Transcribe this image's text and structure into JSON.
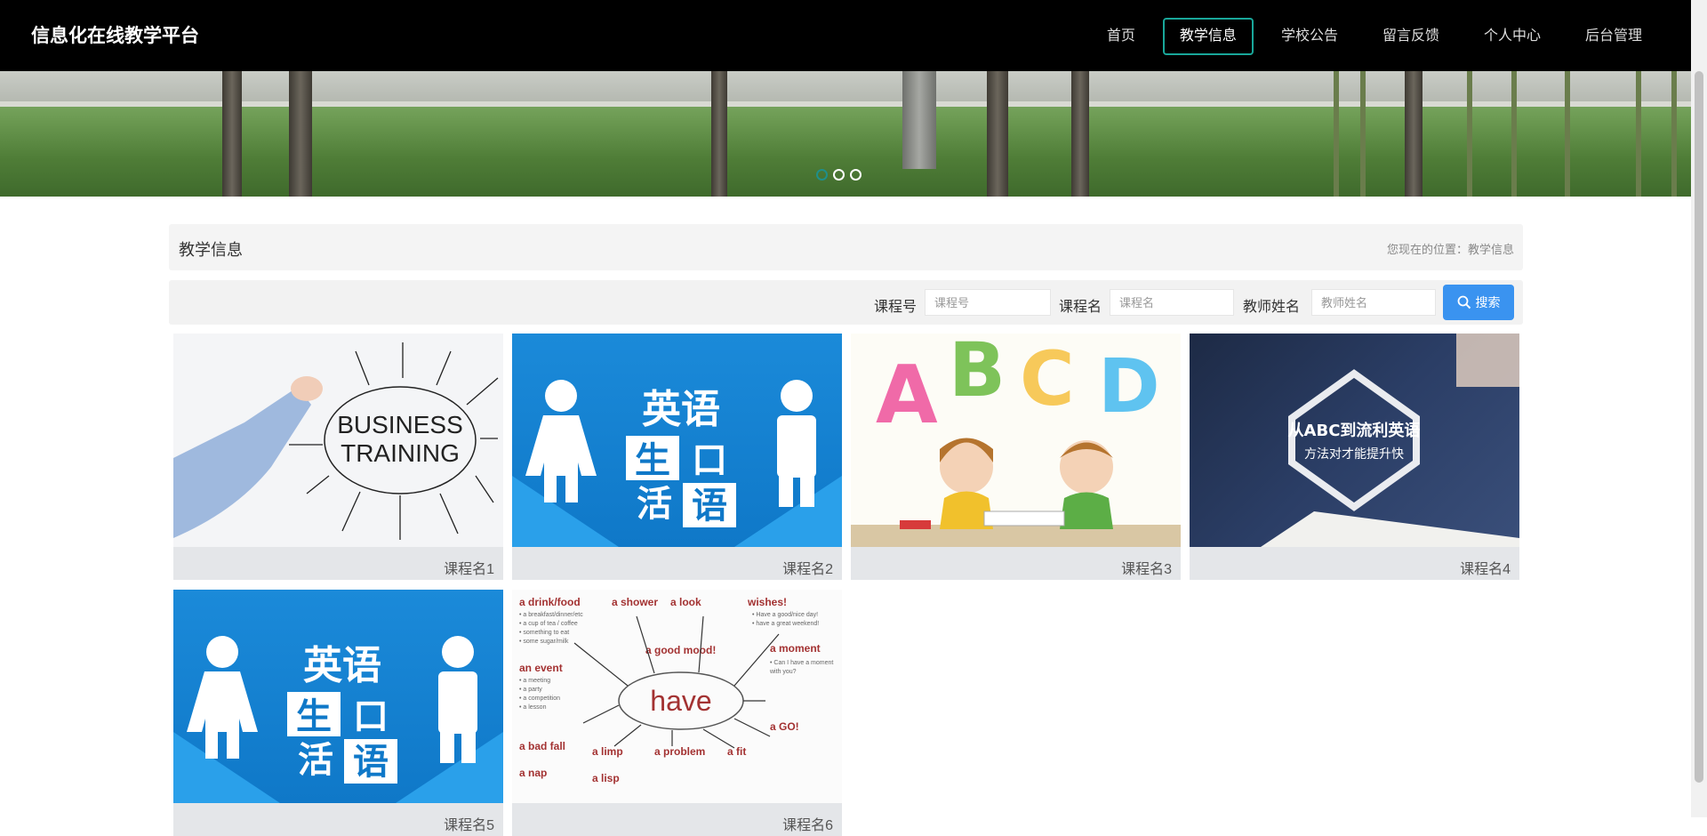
{
  "header": {
    "brand": "信息化在线教学平台",
    "nav": [
      {
        "label": "首页",
        "active": false
      },
      {
        "label": "教学信息",
        "active": true
      },
      {
        "label": "学校公告",
        "active": false
      },
      {
        "label": "留言反馈",
        "active": false
      },
      {
        "label": "个人中心",
        "active": false
      },
      {
        "label": "后台管理",
        "active": false
      }
    ]
  },
  "banner": {
    "slides": 3,
    "active_slide": 1
  },
  "page": {
    "title": "教学信息",
    "breadcrumb": "您现在的位置：教学信息"
  },
  "search": {
    "course_no_label": "课程号",
    "course_no_placeholder": "课程号",
    "course_name_label": "课程名",
    "course_name_placeholder": "课程名",
    "teacher_label": "教师姓名",
    "teacher_placeholder": "教师姓名",
    "button_label": "搜索"
  },
  "courses": [
    {
      "name": "课程名1",
      "image_icon": "business-training-image",
      "image_text": [
        "BUSINESS",
        "TRAINING"
      ]
    },
    {
      "name": "课程名2",
      "image_icon": "english-speaking-image",
      "image_text": [
        "英语",
        "生口",
        "活语"
      ]
    },
    {
      "name": "课程名3",
      "image_icon": "abc-kids-image",
      "image_text": [
        "A",
        "B",
        "C",
        "D"
      ]
    },
    {
      "name": "课程名4",
      "image_icon": "fluent-english-image",
      "image_text": [
        "从ABC到流利英语",
        "方法对才能提升快"
      ]
    },
    {
      "name": "课程名5",
      "image_icon": "english-speaking-image",
      "image_text": [
        "英语",
        "生口",
        "活语"
      ]
    },
    {
      "name": "课程名6",
      "image_icon": "have-mindmap-image",
      "image_text": [
        "have",
        "a drink/food",
        "a shower",
        "a look",
        "wishes!",
        "an event",
        "a good mood!",
        "a moment",
        "a bad fall",
        "a nap",
        "a limp",
        "a problem",
        "a fit",
        "a GO!",
        "a lisp"
      ]
    }
  ],
  "colors": {
    "header_bg": "#000000",
    "nav_active_border": "#19a79a",
    "search_button": "#3a93f0",
    "card_caption_bg": "#e4e6e9"
  }
}
